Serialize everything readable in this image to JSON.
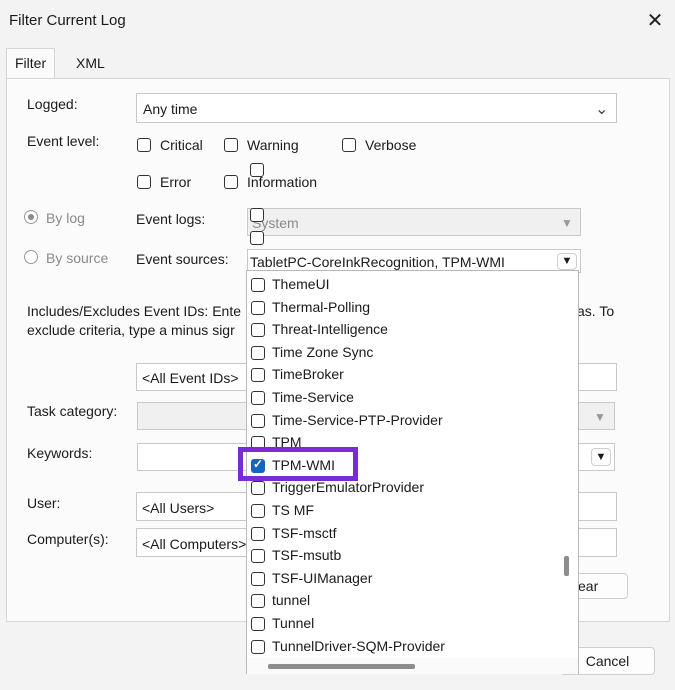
{
  "window": {
    "title": "Filter Current Log",
    "close_icon": "close-icon"
  },
  "tabs": [
    {
      "label": "Filter",
      "active": true
    },
    {
      "label": "XML",
      "active": false
    }
  ],
  "filter": {
    "logged_label": "Logged:",
    "logged_value": "Any time",
    "event_level_label": "Event level:",
    "levels": [
      {
        "label": "Critical",
        "checked": false
      },
      {
        "label": "Warning",
        "checked": false
      },
      {
        "label": "Verbose",
        "checked": false
      },
      {
        "label": "Error",
        "checked": false
      },
      {
        "label": "Information",
        "checked": false
      }
    ],
    "by_log_label": "By log",
    "by_source_label": "By source",
    "event_logs_label": "Event logs:",
    "event_logs_value": "System",
    "event_sources_label": "Event sources:",
    "event_sources_value": "TabletPC-CoreInkRecognition, TPM-WMI",
    "ids_description_1": "Includes/Excludes Event IDs: Ente",
    "ids_description_1_tail": "as. To",
    "ids_description_2": "exclude criteria, type a minus sigr",
    "event_ids_value": "<All Event IDs>",
    "task_category_label": "Task category:",
    "keywords_label": "Keywords:",
    "user_label": "User:",
    "user_value": "<All Users>",
    "computers_label": "Computer(s):",
    "computers_value": "<All Computers>",
    "clear_button_partial": "ear",
    "cancel_button": "Cancel"
  },
  "dropdown": {
    "items": [
      {
        "label": "ThemeUI",
        "checked": false
      },
      {
        "label": "Thermal-Polling",
        "checked": false
      },
      {
        "label": "Threat-Intelligence",
        "checked": false
      },
      {
        "label": "Time Zone Sync",
        "checked": false
      },
      {
        "label": "TimeBroker",
        "checked": false
      },
      {
        "label": "Time-Service",
        "checked": false
      },
      {
        "label": "Time-Service-PTP-Provider",
        "checked": false
      },
      {
        "label": "TPM",
        "checked": false
      },
      {
        "label": "TPM-WMI",
        "checked": true
      },
      {
        "label": "TriggerEmulatorProvider",
        "checked": false
      },
      {
        "label": "TS MF",
        "checked": false
      },
      {
        "label": "TSF-msctf",
        "checked": false
      },
      {
        "label": "TSF-msutb",
        "checked": false
      },
      {
        "label": "TSF-UIManager",
        "checked": false
      },
      {
        "label": "tunnel",
        "checked": false
      },
      {
        "label": "Tunnel",
        "checked": false
      },
      {
        "label": "TunnelDriver-SQM-Provider",
        "checked": false
      }
    ]
  },
  "colors": {
    "highlight": "#7a2bd6",
    "check_accent": "#1764c0"
  }
}
